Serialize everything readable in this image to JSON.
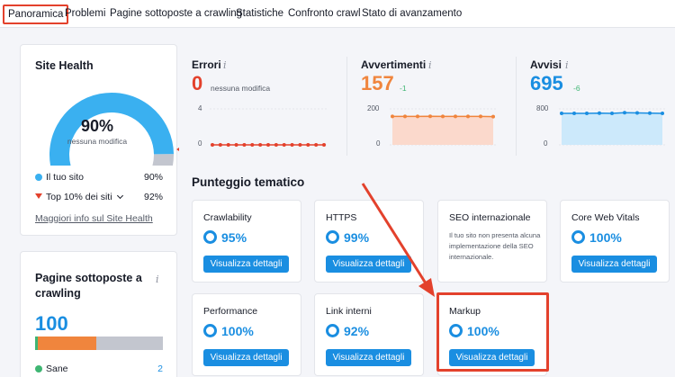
{
  "tabs": [
    {
      "label": "Panoramica",
      "active": true
    },
    {
      "label": "Problemi"
    },
    {
      "label": "Pagine sottoposte a crawling"
    },
    {
      "label": "Statistiche"
    },
    {
      "label": "Confronto crawl"
    },
    {
      "label": "Stato di avanzamento"
    }
  ],
  "site_health": {
    "title": "Site Health",
    "score": "90%",
    "score_fraction": 0.9,
    "score_note": "nessuna modifica",
    "legend": [
      {
        "label": "Il tuo sito",
        "value": "90%"
      },
      {
        "label": "Top 10% dei siti",
        "value": "92%"
      }
    ],
    "more_link": "Maggiori info sul Site Health"
  },
  "crawled_pages": {
    "title": "Pagine sottoposte a crawling",
    "info_icon": "info-icon",
    "value": "100",
    "bar_segments": [
      {
        "fraction": 0.02,
        "color": "#3fb673"
      },
      {
        "fraction": 0.46,
        "color": "#f0853d"
      },
      {
        "fraction": 0.52,
        "color": "#c3c6cf"
      }
    ],
    "legend_label": "Sane",
    "legend_value": "2"
  },
  "metrics": [
    {
      "label": "Errori",
      "value": "0",
      "note": "nessuna modifica",
      "color": "#e3412c",
      "axis_max": "4",
      "axis_min": "0",
      "points": [
        0,
        0,
        0,
        0,
        0,
        0,
        0,
        0,
        0,
        0,
        0,
        0,
        0,
        0,
        0
      ]
    },
    {
      "label": "Avvertimenti",
      "value": "157",
      "delta": "-1",
      "color": "#f0853d",
      "axis_max": "200",
      "axis_min": "0",
      "points": [
        158,
        158,
        158,
        159,
        158,
        158,
        158,
        158,
        157
      ]
    },
    {
      "label": "Avvisi",
      "value": "695",
      "delta": "-6",
      "color": "#1a8ee1",
      "axis_max": "800",
      "axis_min": "0",
      "points": [
        700,
        700,
        700,
        705,
        700,
        715,
        710,
        705,
        700
      ]
    }
  ],
  "thematic": {
    "title": "Punteggio tematico",
    "button_label": "Visualizza dettagli",
    "cards": [
      {
        "title": "Crawlability",
        "score": "95%"
      },
      {
        "title": "HTTPS",
        "score": "99%"
      },
      {
        "title": "SEO internazionale",
        "description": "Il tuo sito non presenta alcuna implementazione della SEO internazionale."
      },
      {
        "title": "Core Web Vitals",
        "score": "100%"
      },
      {
        "title": "Performance",
        "score": "100%"
      },
      {
        "title": "Link interni",
        "score": "92%"
      },
      {
        "title": "Markup",
        "score": "100%"
      }
    ]
  },
  "colors": {
    "accent": "#1a8ee1",
    "highlight": "#e3412c",
    "gauge_track": "#c3c6cf"
  }
}
